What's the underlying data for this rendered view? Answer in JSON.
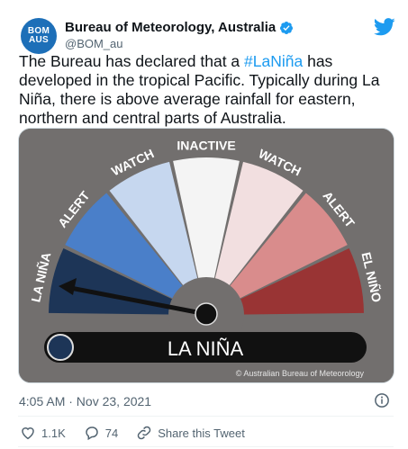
{
  "tweet": {
    "author_name": "Bureau of Meteorology, Australia",
    "handle": "@BOM_au",
    "avatar_line1": "BOM",
    "avatar_line2": "AUS",
    "text_before": "The Bureau has declared that a ",
    "hashtag": "#LaNiña",
    "text_after": " has developed in the tropical Pacific. Typically during La Niña, there is above average rainfall for eastern, northern and central parts of Australia.",
    "timestamp": "4:05 AM · Nov 23, 2021",
    "likes": "1.1K",
    "replies": "74",
    "share_label": "Share this Tweet"
  },
  "gauge": {
    "segments": [
      {
        "label": "LA NIÑA",
        "color": "#1d3557"
      },
      {
        "label": "ALERT",
        "color": "#4a7fc9"
      },
      {
        "label": "WATCH",
        "color": "#c6d7ef"
      },
      {
        "label": "INACTIVE",
        "color": "#f4f4f4"
      },
      {
        "label": "WATCH",
        "color": "#f2dfe0"
      },
      {
        "label": "ALERT",
        "color": "#d98c8c"
      },
      {
        "label": "EL NIÑO",
        "color": "#993434"
      }
    ],
    "status": "LA NIÑA",
    "status_color": "#1d3557",
    "copyright": "© Australian Bureau of Meteorology"
  },
  "colors": {
    "accent": "#1d9bf0",
    "background_panel": "#726f6e"
  },
  "icons": [
    "verified-icon",
    "twitter-bird-icon",
    "info-icon",
    "heart-icon",
    "reply-icon",
    "share-icon"
  ]
}
